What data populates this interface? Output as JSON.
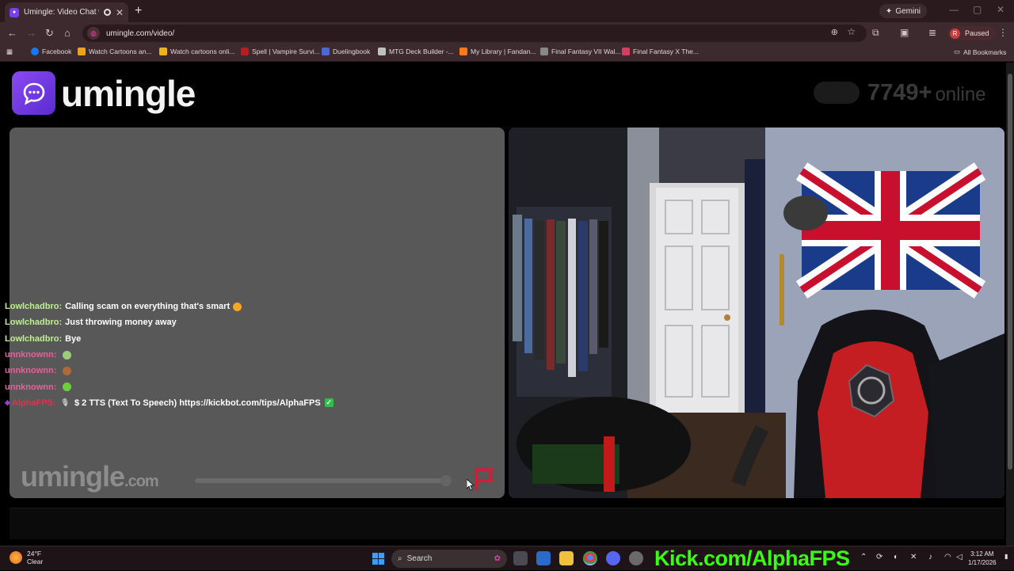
{
  "browser": {
    "tab_title": "Umingle: Video Chat with S",
    "new_tab": "+",
    "gemini_label": "Gemini",
    "url": "umingle.com/video/",
    "profile_initial": "R",
    "profile_status": "Paused"
  },
  "bookmarks": [
    {
      "label": "Facebook",
      "color": "#1877f2"
    },
    {
      "label": "Watch Cartoons an...",
      "color": "#f0a020"
    },
    {
      "label": "Watch cartoons onli...",
      "color": "#f0b020"
    },
    {
      "label": "Spell | Vampire Survi...",
      "color": "#b02020"
    },
    {
      "label": "Duelingbook",
      "color": "#4a6ad0"
    },
    {
      "label": "MTG Deck Builder -...",
      "color": "#c0c0c0"
    },
    {
      "label": "My Library | Fandan...",
      "color": "#ff7a1a"
    },
    {
      "label": "Final Fantasy VII Wal...",
      "color": "#888888"
    },
    {
      "label": "Final Fantasy X The...",
      "color": "#d04060"
    }
  ],
  "all_bookmarks": "All Bookmarks",
  "site": {
    "logo_text": "umingle",
    "online_count": "7749+",
    "online_label": "online",
    "watermark_main": "umingle",
    "watermark_suffix": ".com"
  },
  "chat": [
    {
      "user": "Lowlchadbro:",
      "text": "Calling scam on everything that's smart",
      "user_style": "green",
      "emoji_color": "#f5a623"
    },
    {
      "user": "Lowlchadbro:",
      "text": "Just throwing money away",
      "user_style": "green",
      "emoji_color": ""
    },
    {
      "user": "Lowlchadbro:",
      "text": "Bye",
      "user_style": "green",
      "emoji_color": ""
    },
    {
      "user": "unnknownn:",
      "text": "",
      "user_style": "pink",
      "emoji_color": "#9acd7a"
    },
    {
      "user": "unnknownn:",
      "text": "",
      "user_style": "pink",
      "emoji_color": "#b06a3a"
    },
    {
      "user": "unnknownn:",
      "text": "",
      "user_style": "pink",
      "emoji_color": "#6cd03c"
    },
    {
      "user": "AlphaFPS:",
      "text": "$ 2 TTS (Text To Speech) https://kickbot.com/tips/AlphaFPS",
      "user_style": "red",
      "emoji_color": ""
    }
  ],
  "taskbar": {
    "temperature": "24°F",
    "weather": "Clear",
    "search_label": "Search",
    "overlay_text": "Kick.com/AlphaFPS",
    "time": "3:12 AM",
    "date": "1/17/2026"
  },
  "colors": {
    "accent_purple": "#7b3fe4",
    "chat_green": "#bff08f",
    "chat_pink": "#e8609a",
    "kick_green": "#39ff14"
  }
}
